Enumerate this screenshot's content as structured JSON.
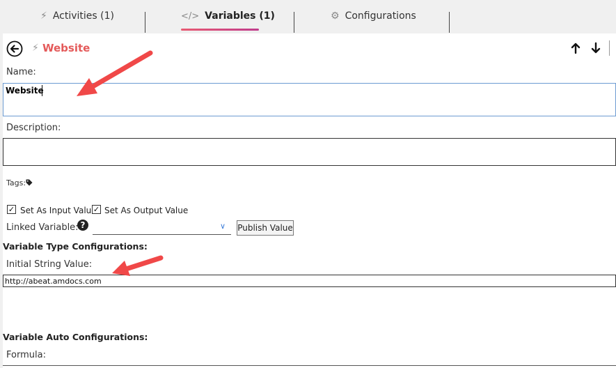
{
  "tabs": [
    {
      "label": "Activities (1)",
      "icon": "bolt-icon",
      "active": false
    },
    {
      "label": "Variables (1)",
      "icon": "code-icon",
      "active": true
    },
    {
      "label": "Configurations",
      "icon": "gear-icon",
      "active": false
    }
  ],
  "header": {
    "title": "Website"
  },
  "form": {
    "name_label": "Name:",
    "name_value": "Website",
    "description_label": "Description:",
    "description_value": "",
    "tags_label": "Tags:",
    "set_input_label": "Set As Input Value",
    "set_input_checked": true,
    "set_output_label": "Set As Output Value",
    "set_output_checked": true,
    "linked_variable_label": "Linked Variable:",
    "linked_variable_value": "",
    "publish_button": "Publish Value",
    "type_config_heading": "Variable Type Configurations:",
    "initial_string_label": "Initial String Value:",
    "initial_string_value": "http://abeat.amdocs.com",
    "auto_config_heading": "Variable Auto Configurations:",
    "formula_label": "Formula:"
  },
  "colors": {
    "title": "#e45a5a",
    "tab_underline": "#d04a80",
    "callout_arrow": "#f04848",
    "focus_border": "#6c9bd2"
  }
}
